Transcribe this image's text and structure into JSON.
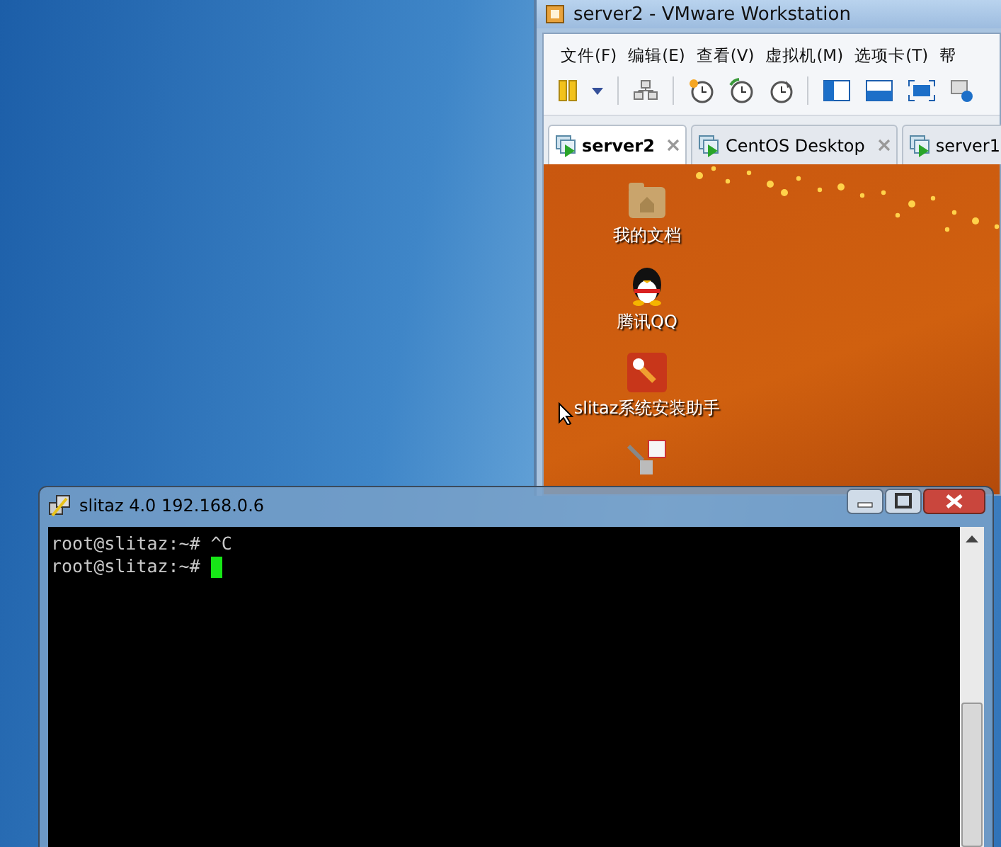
{
  "vmware_window": {
    "title": "server2 - VMware Workstation",
    "menu": [
      "文件(F)",
      "编辑(E)",
      "查看(V)",
      "虚拟机(M)",
      "选项卡(T)",
      "帮"
    ],
    "tabs": [
      {
        "label": "server2",
        "selected": true,
        "closable": true
      },
      {
        "label": "CentOS Desktop",
        "selected": false,
        "closable": true
      },
      {
        "label": "server1",
        "selected": false,
        "closable": false
      }
    ],
    "guest_desktop": {
      "icons": [
        {
          "kind": "folder",
          "label": "我的文档"
        },
        {
          "kind": "penguin",
          "label": "腾讯QQ"
        },
        {
          "kind": "wrench",
          "label": "slitaz系统安装助手"
        },
        {
          "kind": "network"
        }
      ]
    }
  },
  "terminal_window": {
    "title": "slitaz 4.0 192.168.0.6",
    "lines": [
      {
        "text": "root@slitaz:~# ^C",
        "cursor": false
      },
      {
        "text": "root@slitaz:~# ",
        "cursor": true
      }
    ]
  }
}
